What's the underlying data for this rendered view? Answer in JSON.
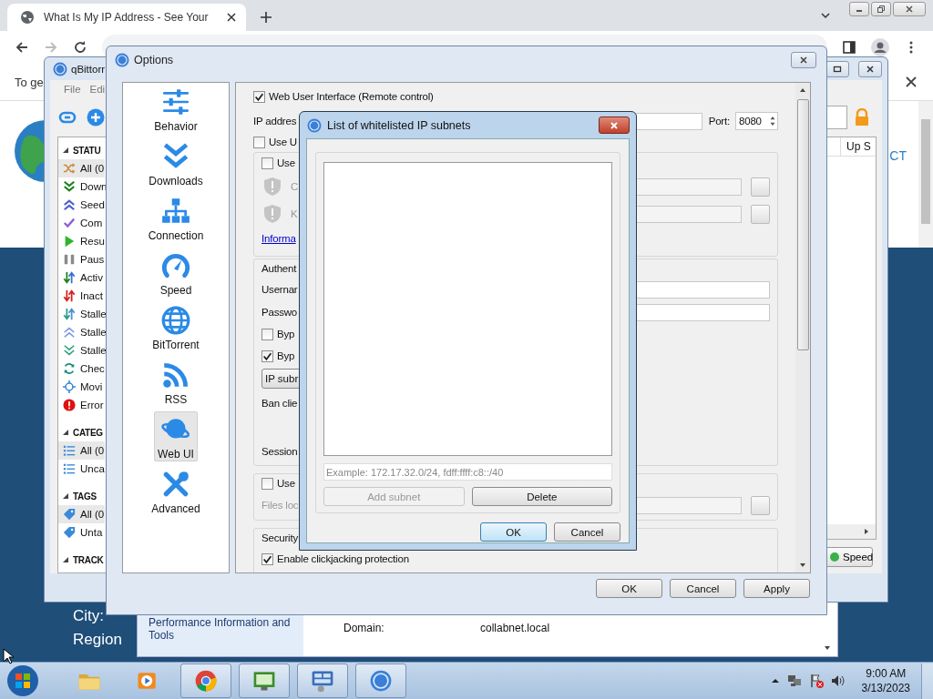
{
  "browser": {
    "tab_title": "What Is My IP Address - See Your",
    "info_text": "To ge"
  },
  "webpage": {
    "fragment": "CT",
    "labels": [
      "City:",
      "Region"
    ]
  },
  "system_window": {
    "sidebar_link": "Performance Information and Tools",
    "field_label": "Domain:",
    "field_value": "collabnet.local"
  },
  "qbittorrent": {
    "title": "qBittorr",
    "menu": [
      "File",
      "Edi"
    ],
    "sidebar": [
      {
        "heading": "STATU",
        "items": [
          {
            "label": "All (0",
            "kind": "all",
            "selected": true
          },
          {
            "label": "Down",
            "kind": "downloading",
            "selected": false
          },
          {
            "label": "Seed",
            "kind": "seeding",
            "selected": false
          },
          {
            "label": "Com",
            "kind": "completed",
            "selected": false
          },
          {
            "label": "Resu",
            "kind": "resumed",
            "selected": false
          },
          {
            "label": "Paus",
            "kind": "paused",
            "selected": false
          },
          {
            "label": "Activ",
            "kind": "active",
            "selected": false
          },
          {
            "label": "Inact",
            "kind": "inactive",
            "selected": false
          },
          {
            "label": "Stalle",
            "kind": "stalled",
            "selected": false
          },
          {
            "label": "Stalle",
            "kind": "stalled_up",
            "selected": false
          },
          {
            "label": "Stalle",
            "kind": "stalled_down",
            "selected": false
          },
          {
            "label": "Chec",
            "kind": "checking",
            "selected": false
          },
          {
            "label": "Movi",
            "kind": "moving",
            "selected": false
          },
          {
            "label": "Error",
            "kind": "errored",
            "selected": false
          }
        ]
      },
      {
        "heading": "CATEG",
        "items": [
          {
            "label": "All (0",
            "kind": "category",
            "selected": true
          },
          {
            "label": "Unca",
            "kind": "category",
            "selected": false
          }
        ]
      },
      {
        "heading": "TAGS",
        "items": [
          {
            "label": "All (0",
            "kind": "tag",
            "selected": true
          },
          {
            "label": "Unta",
            "kind": "tag",
            "selected": false
          }
        ]
      },
      {
        "heading": "TRACK"
      }
    ],
    "column_header": "Up S",
    "speed_button": "Speed"
  },
  "options": {
    "title": "Options",
    "nav": [
      {
        "label": "Behavior",
        "kind": "behavior",
        "selected": false
      },
      {
        "label": "Downloads",
        "kind": "downloads",
        "selected": false
      },
      {
        "label": "Connection",
        "kind": "connection",
        "selected": false
      },
      {
        "label": "Speed",
        "kind": "speed",
        "selected": false
      },
      {
        "label": "BitTorrent",
        "kind": "bittorrent",
        "selected": false
      },
      {
        "label": "RSS",
        "kind": "rss",
        "selected": false
      },
      {
        "label": "Web UI",
        "kind": "webui",
        "selected": true
      },
      {
        "label": "Advanced",
        "kind": "advanced",
        "selected": false
      }
    ],
    "web_ui": {
      "enable": {
        "label": "Web User Interface (Remote control)",
        "checked": true
      },
      "ip_label": "IP addres",
      "port_label": "Port:",
      "port": "8080",
      "https": {
        "label": "Use U",
        "checked": false
      },
      "cert_group": {
        "custom": {
          "label": "Use",
          "checked": false
        },
        "rows": [
          {
            "label": "C"
          },
          {
            "label": "K"
          }
        ],
        "link": "Informa"
      },
      "auth_group": {
        "title": "Authent",
        "username_label": "Usernar",
        "password_label": "Passwo",
        "bypass": [
          {
            "label": "Byp",
            "checked": false
          },
          {
            "label": "Byp",
            "checked": true
          }
        ],
        "subnet_button": "IP subr",
        "ban_label": "Ban clie",
        "session_label": "Session"
      },
      "alt_ui": {
        "checkbox": {
          "label": "Use",
          "checked": false
        },
        "files_label": "Files loc"
      },
      "security": {
        "title": "Security",
        "clickjacking": {
          "label": "Enable clickjacking protection",
          "checked": true
        }
      }
    },
    "buttons": [
      "OK",
      "Cancel",
      "Apply"
    ]
  },
  "dialog": {
    "title": "List of whitelisted IP subnets",
    "placeholder": "Example: 172.17.32.0/24, fdff:ffff:c8::/40",
    "add_button": {
      "label": "Add subnet",
      "disabled": true
    },
    "delete_button": "Delete",
    "buttons": [
      {
        "label": "OK",
        "default": true
      },
      {
        "label": "Cancel",
        "default": false
      }
    ]
  },
  "taskbar": {
    "apps": [
      {
        "kind": "explorer",
        "running": false
      },
      {
        "kind": "media",
        "running": false
      },
      {
        "kind": "chrome",
        "running": true
      },
      {
        "kind": "csharp",
        "running": true
      },
      {
        "kind": "network",
        "running": true
      },
      {
        "kind": "qbittorrent",
        "running": true
      }
    ],
    "time": "9:00 AM",
    "date": "3/13/2023"
  }
}
